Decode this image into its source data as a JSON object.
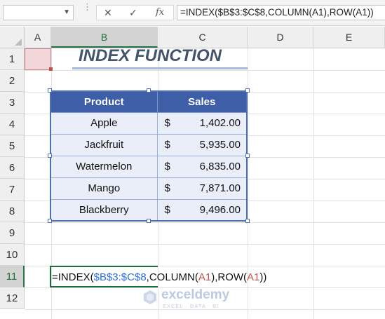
{
  "formula_bar": {
    "name_box": "",
    "cancel_icon": "✕",
    "enter_icon": "✓",
    "fx_icon": "fx",
    "formula": "=INDEX($B$3:$C$8,COLUMN(A1),ROW(A1))"
  },
  "columns": [
    "A",
    "B",
    "C",
    "D",
    "E"
  ],
  "rows": [
    "1",
    "2",
    "3",
    "4",
    "5",
    "6",
    "7",
    "8",
    "9",
    "10",
    "11",
    "12"
  ],
  "title": "INDEX FUNCTION",
  "table": {
    "headers": [
      "Product",
      "Sales"
    ],
    "rows": [
      {
        "product": "Apple",
        "currency": "$",
        "amount": "1,402.00"
      },
      {
        "product": "Jackfruit",
        "currency": "$",
        "amount": "5,935.00"
      },
      {
        "product": "Watermelon",
        "currency": "$",
        "amount": "6,835.00"
      },
      {
        "product": "Mango",
        "currency": "$",
        "amount": "7,871.00"
      },
      {
        "product": "Blackberry",
        "currency": "$",
        "amount": "9,496.00"
      }
    ]
  },
  "cell_b11": {
    "p1": "=INDEX(",
    "range": "$B$3:$C$8",
    "p2": ",COLUMN(",
    "ref1": "A1",
    "p3": "),ROW(",
    "ref2": "A1",
    "p4": "))"
  },
  "watermark": {
    "name": "exceldemy",
    "tagline": "EXCEL · DATA · BI"
  },
  "colors": {
    "table_header": "#3e5ea8",
    "table_body": "#e9eef8",
    "title": "#44546a",
    "active_cell_border": "#1f6b3d"
  }
}
